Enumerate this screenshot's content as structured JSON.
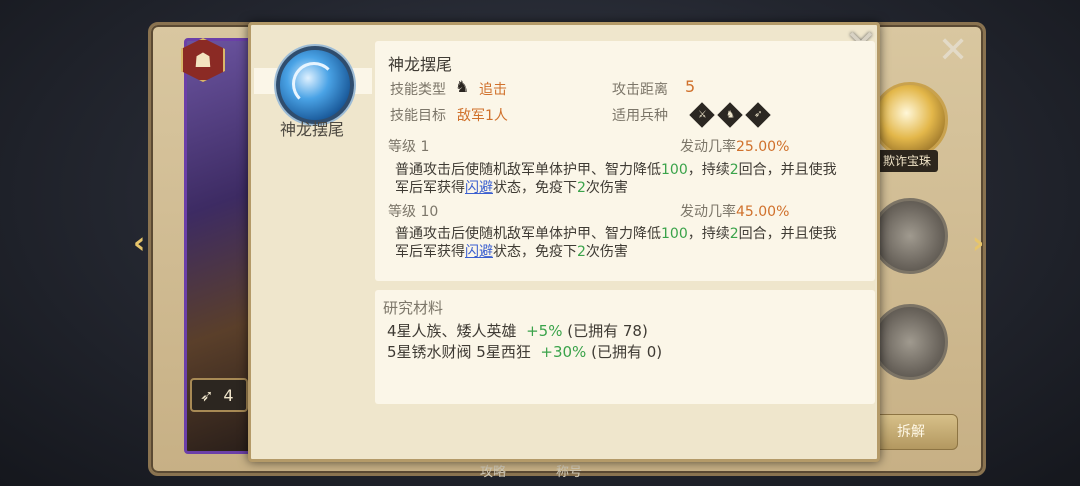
{
  "skill": {
    "tab_label": "神龙摆尾",
    "name": "神龙摆尾",
    "type_label": "技能类型",
    "type_value": "追击",
    "range_label": "攻击距离",
    "range_value": "5",
    "target_label": "技能目标",
    "target_value": "敌军1人",
    "troop_label": "适用兵种",
    "troop_icons": [
      "infantry-icon",
      "cavalry-icon",
      "archer-icon"
    ]
  },
  "levels": [
    {
      "label": "等级 1",
      "rate_label": "发动几率",
      "rate_value": "25.00%",
      "desc": {
        "p1": "普通攻击后使随机敌军单体护甲、智力降低",
        "n1": "100",
        "p2": "，持续",
        "n2": "2",
        "p3": "回合，并且使我",
        "p4": "军后军获得",
        "link": "闪避",
        "p5": "状态，免疫下",
        "n3": "2",
        "p6": "次伤害"
      }
    },
    {
      "label": "等级 10",
      "rate_label": "发动几率",
      "rate_value": "45.00%",
      "desc": {
        "p1": "普通攻击后使随机敌军单体护甲、智力降低",
        "n1": "100",
        "p2": "，持续",
        "n2": "2",
        "p3": "回合，并且使我",
        "p4": "军后军获得",
        "link": "闪避",
        "p5": "状态，免疫下",
        "n3": "2",
        "p6": "次伤害"
      }
    }
  ],
  "materials": {
    "title": "研究材料",
    "items": [
      {
        "name": "4星人族、矮人英雄",
        "bonus": "+5%",
        "owned": "(已拥有 78)"
      },
      {
        "name": "5星锈水财阀 5星西狂",
        "bonus": "+30%",
        "owned": "(已拥有 0)"
      }
    ]
  },
  "background": {
    "hero_level": "4",
    "treasure_label": "欺诈宝珠",
    "dismantle_label": "拆解",
    "bottom_tabs": [
      "攻略",
      "称号"
    ]
  },
  "colors": {
    "accent_orange": "#d0712c",
    "number_green": "#3aa34a",
    "link_blue": "#3b5fd0",
    "hero_frame_purple": "#6b3fa8"
  }
}
